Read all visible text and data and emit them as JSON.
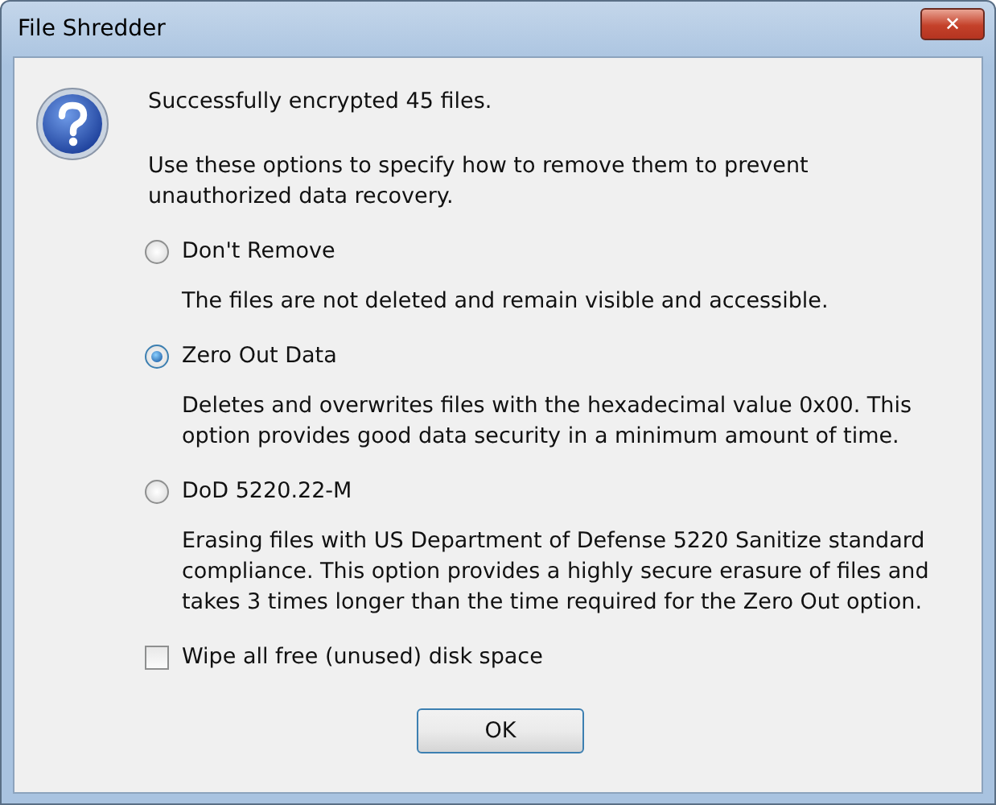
{
  "window": {
    "title": "File Shredder",
    "close": "✕"
  },
  "message": "Successfully encrypted 45 files.",
  "instruction": "Use these options to specify how to remove them to prevent unauthorized data recovery.",
  "options": [
    {
      "label": "Don't Remove",
      "selected": false,
      "description": "The files are not deleted and remain visible and accessible."
    },
    {
      "label": "Zero Out Data",
      "selected": true,
      "description": "Deletes and overwrites files with the hexadecimal value 0x00. This option provides good data security in a minimum amount of time."
    },
    {
      "label": "DoD 5220.22-M",
      "selected": false,
      "description": "Erasing files with US Department of Defense 5220 Sanitize standard compliance. This option provides a highly secure erasure of files and takes 3 times longer than the time required for the Zero Out option."
    }
  ],
  "wipe": {
    "label": "Wipe all free (unused) disk space",
    "checked": false
  },
  "buttons": [
    "OK"
  ]
}
